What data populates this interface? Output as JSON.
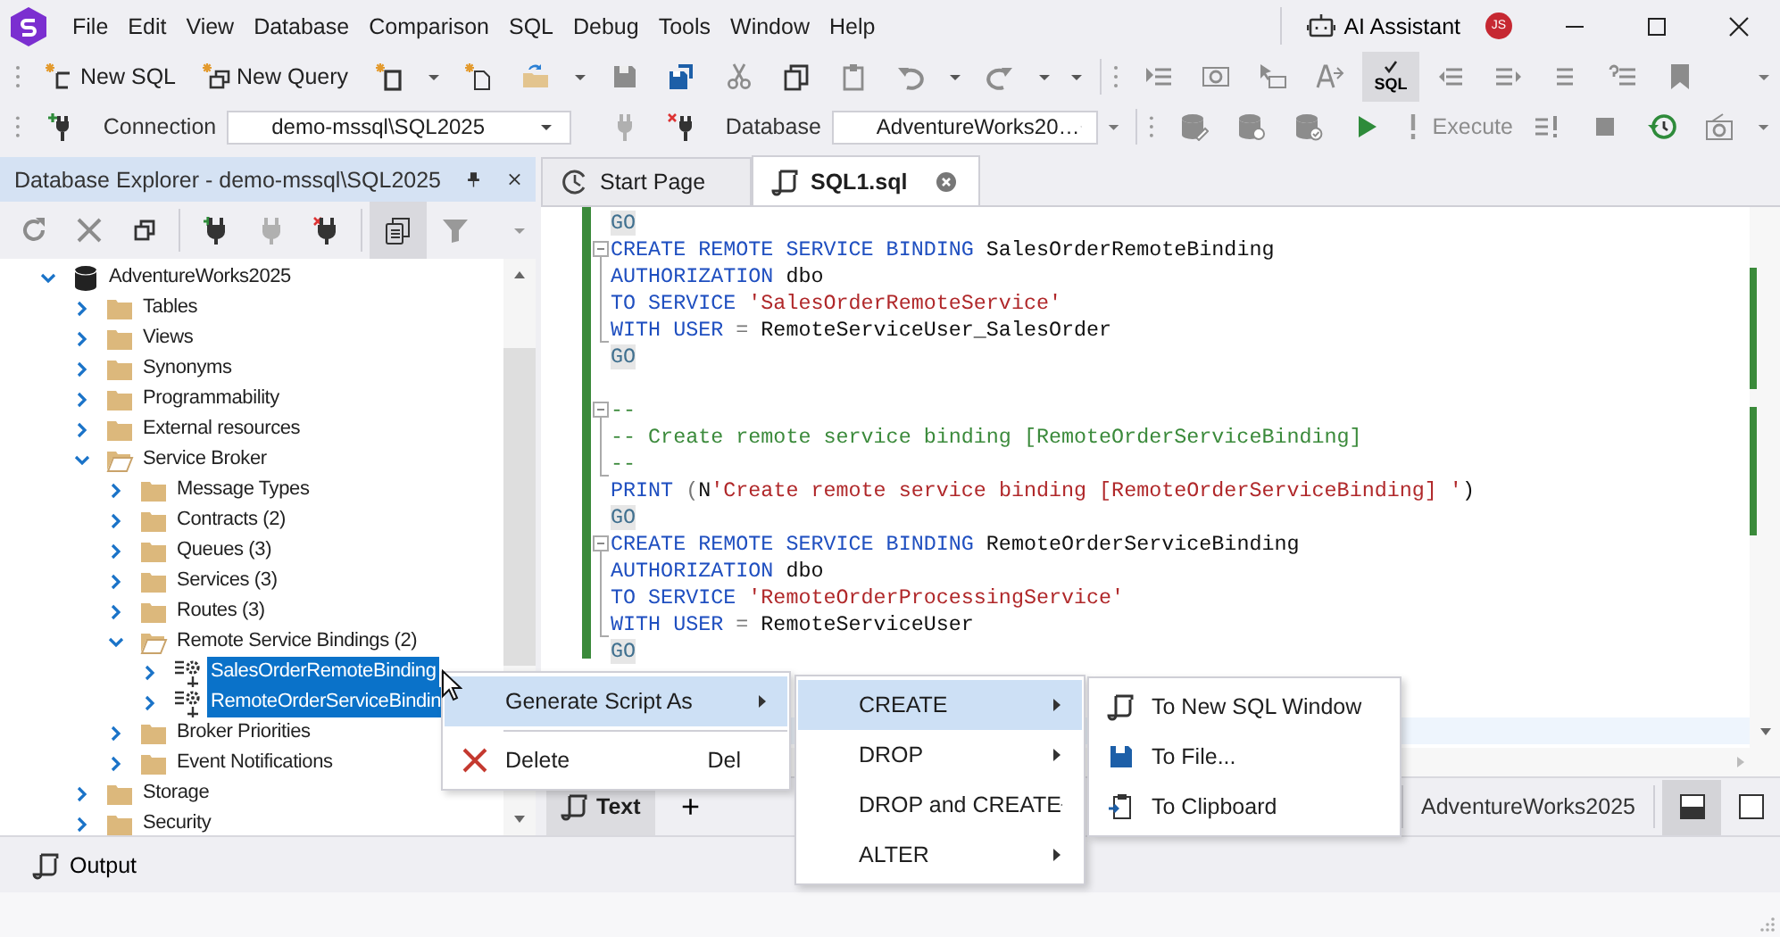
{
  "menu_bar": {
    "items": [
      "File",
      "Edit",
      "View",
      "Database",
      "Comparison",
      "SQL",
      "Debug",
      "Tools",
      "Window",
      "Help"
    ],
    "ai_assistant": "AI Assistant",
    "avatar": "JS"
  },
  "toolbar": {
    "new_sql": "New SQL",
    "new_query": "New Query",
    "sql_button": {
      "label": "SQL",
      "selected": true
    }
  },
  "connection_bar": {
    "connection_label": "Connection",
    "connection_value": "demo-mssql\\SQL2025",
    "database_label": "Database",
    "database_value": "AdventureWorks20…",
    "execute": {
      "label": "Execute",
      "disabled": true
    }
  },
  "explorer": {
    "title": "Database Explorer - demo-mssql\\SQL2025",
    "tree": [
      {
        "label": "AdventureWorks2025",
        "kind": "database",
        "expanded": true,
        "selected": false,
        "children": [
          {
            "label": "Tables",
            "kind": "folder",
            "expanded": false,
            "selected": false
          },
          {
            "label": "Views",
            "kind": "folder",
            "expanded": false,
            "selected": false
          },
          {
            "label": "Synonyms",
            "kind": "folder",
            "expanded": false,
            "selected": false
          },
          {
            "label": "Programmability",
            "kind": "folder",
            "expanded": false,
            "selected": false
          },
          {
            "label": "External resources",
            "kind": "folder",
            "expanded": false,
            "selected": false
          },
          {
            "label": "Service Broker",
            "kind": "folder",
            "expanded": true,
            "selected": false,
            "children": [
              {
                "label": "Message Types",
                "kind": "folder",
                "expanded": false,
                "selected": false
              },
              {
                "label": "Contracts (2)",
                "kind": "folder",
                "expanded": false,
                "selected": false
              },
              {
                "label": "Queues (3)",
                "kind": "folder",
                "expanded": false,
                "selected": false
              },
              {
                "label": "Services (3)",
                "kind": "folder",
                "expanded": false,
                "selected": false
              },
              {
                "label": "Routes (3)",
                "kind": "folder",
                "expanded": false,
                "selected": false
              },
              {
                "label": "Remote Service Bindings (2)",
                "kind": "folder",
                "expanded": true,
                "selected": false,
                "children": [
                  {
                    "label": "SalesOrderRemoteBinding",
                    "kind": "binding",
                    "expanded": false,
                    "selected": true
                  },
                  {
                    "label": "RemoteOrderServiceBindin",
                    "kind": "binding",
                    "expanded": false,
                    "selected": true
                  }
                ]
              },
              {
                "label": "Broker Priorities",
                "kind": "folder",
                "expanded": false,
                "selected": false
              },
              {
                "label": "Event Notifications",
                "kind": "folder",
                "expanded": false,
                "selected": false
              }
            ]
          },
          {
            "label": "Storage",
            "kind": "folder",
            "expanded": false,
            "selected": false
          },
          {
            "label": "Security",
            "kind": "folder",
            "expanded": false,
            "selected": false
          }
        ]
      }
    ]
  },
  "tabs": [
    {
      "label": "Start Page",
      "selected": false
    },
    {
      "label": "SQL1.sql",
      "selected": true
    }
  ],
  "editor": {
    "lines": [
      {
        "kind": "code",
        "tokens": [
          {
            "kind": "batch",
            "text": "GO"
          }
        ]
      },
      {
        "kind": "code",
        "fold_start": true,
        "tokens": [
          {
            "kind": "keyword",
            "text": "CREATE REMOTE SERVICE BINDING"
          },
          {
            "kind": "plain",
            "text": " SalesOrderRemoteBinding"
          }
        ]
      },
      {
        "kind": "code",
        "fold_inner": true,
        "tokens": [
          {
            "kind": "keyword",
            "text": "AUTHORIZATION"
          },
          {
            "kind": "plain",
            "text": " dbo"
          }
        ]
      },
      {
        "kind": "code",
        "fold_inner": true,
        "tokens": [
          {
            "kind": "keyword",
            "text": "TO SERVICE"
          },
          {
            "kind": "string",
            "text": " 'SalesOrderRemoteService'"
          }
        ]
      },
      {
        "kind": "code",
        "fold_end": true,
        "tokens": [
          {
            "kind": "keyword",
            "text": "WITH USER"
          },
          {
            "kind": "operator",
            "text": " ="
          },
          {
            "kind": "plain",
            "text": " RemoteServiceUser_SalesOrder"
          }
        ]
      },
      {
        "kind": "code",
        "tokens": [
          {
            "kind": "batch",
            "text": "GO"
          }
        ]
      },
      {
        "kind": "blank",
        "current": false
      },
      {
        "kind": "code",
        "fold_start": true,
        "tokens": [
          {
            "kind": "comment",
            "text": "--"
          }
        ]
      },
      {
        "kind": "code",
        "fold_inner": true,
        "tokens": [
          {
            "kind": "comment",
            "text": "-- Create remote service binding [RemoteOrderServiceBinding]"
          }
        ]
      },
      {
        "kind": "code",
        "fold_end": true,
        "tokens": [
          {
            "kind": "comment",
            "text": "--"
          }
        ]
      },
      {
        "kind": "code",
        "tokens": [
          {
            "kind": "keyword",
            "text": "PRINT"
          },
          {
            "kind": "operator",
            "text": " ("
          },
          {
            "kind": "plain",
            "text": "N"
          },
          {
            "kind": "string",
            "text": "'Create remote service binding [RemoteOrderServiceBinding] '"
          },
          {
            "kind": "plain",
            "text": ")"
          }
        ]
      },
      {
        "kind": "code",
        "tokens": [
          {
            "kind": "batch",
            "text": "GO"
          }
        ]
      },
      {
        "kind": "code",
        "fold_start": true,
        "tokens": [
          {
            "kind": "keyword",
            "text": "CREATE REMOTE SERVICE BINDING"
          },
          {
            "kind": "plain",
            "text": " RemoteOrderServiceBinding"
          }
        ]
      },
      {
        "kind": "code",
        "fold_inner": true,
        "tokens": [
          {
            "kind": "keyword",
            "text": "AUTHORIZATION"
          },
          {
            "kind": "plain",
            "text": " dbo"
          }
        ]
      },
      {
        "kind": "code",
        "fold_inner": true,
        "tokens": [
          {
            "kind": "keyword",
            "text": "TO SERVICE"
          },
          {
            "kind": "string",
            "text": " 'RemoteOrderProcessingService'"
          }
        ]
      },
      {
        "kind": "code",
        "fold_end": true,
        "tokens": [
          {
            "kind": "keyword",
            "text": "WITH USER"
          },
          {
            "kind": "operator",
            "text": " ="
          },
          {
            "kind": "plain",
            "text": " RemoteServiceUser"
          }
        ]
      },
      {
        "kind": "code",
        "tokens": [
          {
            "kind": "batch",
            "text": "GO"
          }
        ]
      },
      {
        "kind": "blank",
        "current": false
      },
      {
        "kind": "blank",
        "current": false
      },
      {
        "kind": "blank",
        "current": true
      }
    ]
  },
  "result_bar": {
    "tabs": [
      {
        "label": "Text",
        "selected": true
      }
    ],
    "add": "+",
    "database": "AdventureWorks2025",
    "layout_buttons": [
      {
        "kind": "split",
        "selected": true
      },
      {
        "kind": "single",
        "selected": false
      }
    ]
  },
  "context_menu": {
    "items": [
      {
        "kind": "item",
        "label": "Generate Script As",
        "submenu": true,
        "selected": true
      },
      {
        "kind": "separator"
      },
      {
        "kind": "item",
        "label": "Delete",
        "shortcut": "Del",
        "submenu": false,
        "selected": false
      }
    ]
  },
  "script_menu": {
    "items": [
      {
        "label": "CREATE",
        "selected": true
      },
      {
        "label": "DROP",
        "selected": false
      },
      {
        "label": "DROP and CREATE",
        "selected": false
      },
      {
        "label": "ALTER",
        "selected": false
      }
    ]
  },
  "target_menu": {
    "items": [
      {
        "label": "To New SQL Window",
        "kind": "window"
      },
      {
        "label": "To File...",
        "kind": "file"
      },
      {
        "label": "To Clipboard",
        "kind": "clipboard"
      }
    ]
  },
  "output": {
    "label": "Output"
  }
}
